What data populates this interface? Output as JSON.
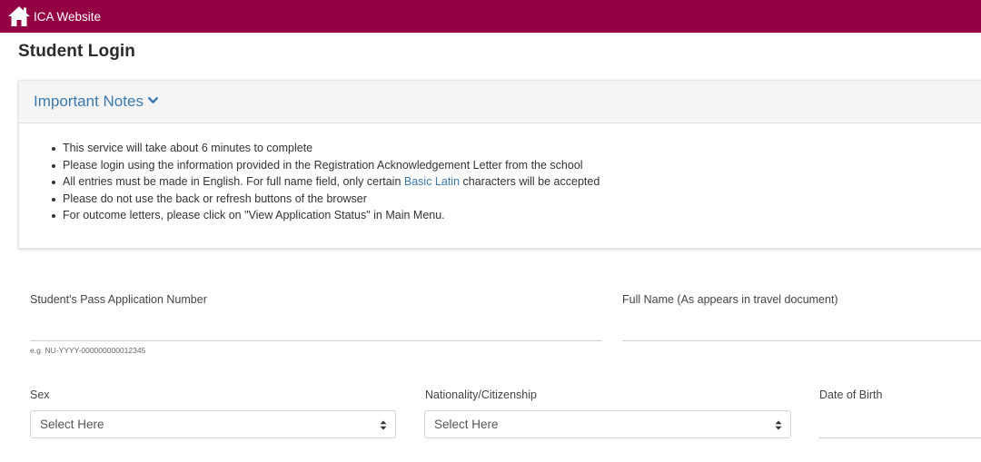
{
  "header": {
    "site_name": "ICA Website",
    "brand_color": "#940044",
    "home_icon": "home-icon"
  },
  "page": {
    "title": "Student Login"
  },
  "notes": {
    "title": "Important Notes",
    "toggle_icon": "chevron-down-icon",
    "items": [
      {
        "text": "This service will take about 6 minutes to complete"
      },
      {
        "text": "Please login using the information provided in the Registration Acknowledgement Letter from the school"
      },
      {
        "before": "All entries must be made in English. For full name field, only certain ",
        "link": "Basic Latin",
        "after": " characters will be accepted"
      },
      {
        "text": "Please do not use the back or refresh buttons of the browser"
      },
      {
        "text": "For outcome letters, please click on \"View Application Status\" in Main Menu."
      }
    ],
    "link_color": "#3a78ad"
  },
  "form": {
    "application_number": {
      "label": "Student's Pass Application Number",
      "value": "",
      "hint": "e.g. NU-YYYY-000000000012345"
    },
    "full_name": {
      "label": "Full Name (As appears in travel document)",
      "value": ""
    },
    "sex": {
      "label": "Sex",
      "selected": "Select Here"
    },
    "nationality": {
      "label": "Nationality/Citizenship",
      "selected": "Select Here"
    },
    "date_of_birth": {
      "label": "Date of Birth",
      "value": ""
    }
  }
}
